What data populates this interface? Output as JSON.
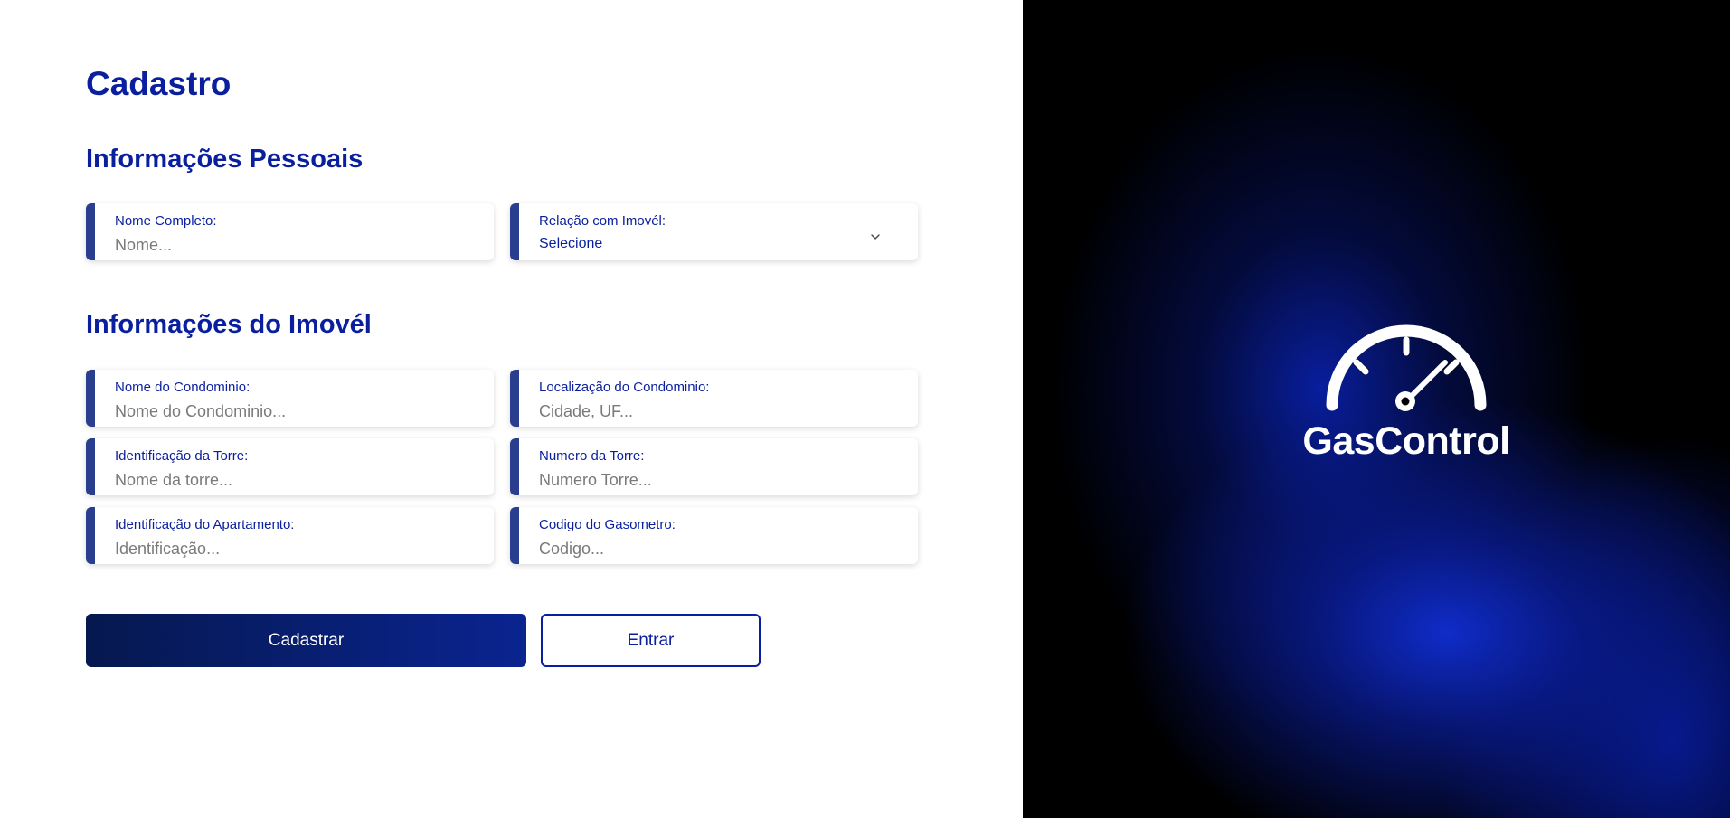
{
  "page": {
    "title": "Cadastro"
  },
  "personal": {
    "section_title": "Informações Pessoais",
    "full_name": {
      "label": "Nome Completo:",
      "placeholder": "Nome...",
      "value": ""
    },
    "relation": {
      "label": "Relação com Imovél:",
      "selected": "Selecione"
    }
  },
  "property": {
    "section_title": "Informações do Imovél",
    "condo_name": {
      "label": "Nome do Condominio:",
      "placeholder": "Nome do Condominio...",
      "value": ""
    },
    "condo_location": {
      "label": "Localização do Condominio:",
      "placeholder": "Cidade, UF...",
      "value": ""
    },
    "tower_id": {
      "label": "Identificação da Torre:",
      "placeholder": "Nome da torre...",
      "value": ""
    },
    "tower_number": {
      "label": "Numero da Torre:",
      "placeholder": "Numero Torre...",
      "value": ""
    },
    "apartment_id": {
      "label": "Identificação do Apartamento:",
      "placeholder": "Identificação...",
      "value": ""
    },
    "gas_meter_code": {
      "label": "Codigo do Gasometro:",
      "placeholder": "Codigo...",
      "value": ""
    }
  },
  "actions": {
    "register_label": "Cadastrar",
    "login_label": "Entrar"
  },
  "brand": {
    "name": "GasControl",
    "icon": "gauge-icon"
  },
  "colors": {
    "accent": "#0a1f9e",
    "field_bar": "#2a3e8f",
    "primary_button_start": "#06184f",
    "primary_button_end": "#0a2490",
    "brand_panel_bg": "#000000",
    "brand_panel_glow": "#102ed2"
  }
}
